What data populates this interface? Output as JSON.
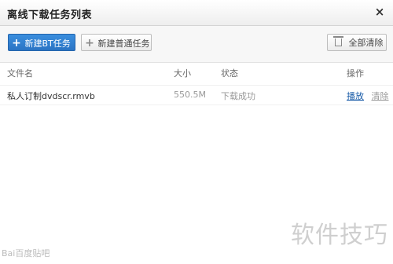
{
  "dialog": {
    "title": "离线下载任务列表",
    "close_label": "×"
  },
  "toolbar": {
    "new_bt_label": "新建BT任务",
    "new_normal_label": "新建普通任务",
    "clear_all_label": "全部清除",
    "add_icon": "+"
  },
  "table": {
    "headers": [
      "文件名",
      "大小",
      "状态",
      "操作"
    ],
    "rows": [
      {
        "filename": "私人订制dvdscr.rmvb",
        "size": "550.5M",
        "status": "下载成功",
        "action_play": "播放",
        "action_clear": "清除"
      }
    ]
  },
  "watermarks": {
    "right": "软件技巧",
    "left": "Bai百度贴吧"
  },
  "colors": {
    "primary_button": "#2a74c4",
    "link": "#1a5ca8",
    "muted_text": "#999999"
  }
}
